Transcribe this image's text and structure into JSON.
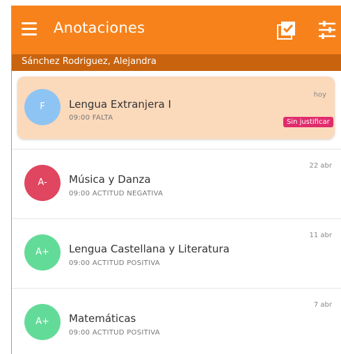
{
  "appbar": {
    "title": "Anotaciones",
    "menu_icon": "menu-icon",
    "actions": [
      "checklist-icon",
      "tune-icon"
    ],
    "color": "#f7821b"
  },
  "student": {
    "name": "Sánchez Rodriguez, Alejandra"
  },
  "annotations": [
    {
      "avatar_text": "F",
      "avatar_color": "#8ec4f3",
      "subject": "Lengua Extranjera I",
      "detail": "09:00 FALTA",
      "date": "hoy",
      "badge": "Sin justificar",
      "selected": true
    },
    {
      "avatar_text": "A-",
      "avatar_color": "#e0465f",
      "subject": "Música y Danza",
      "detail": "09:00 ACTITUD NEGATIVA",
      "date": "22 abr"
    },
    {
      "avatar_text": "A+",
      "avatar_color": "#63db98",
      "subject": "Lengua Castellana y Literatura",
      "detail": "09:00 ACTITUD POSITIVA",
      "date": "11 abr"
    },
    {
      "avatar_text": "A+",
      "avatar_color": "#63db98",
      "subject": "Matemáticas",
      "detail": "09:00 ACTITUD POSITIVA",
      "date": "7 abr"
    }
  ]
}
